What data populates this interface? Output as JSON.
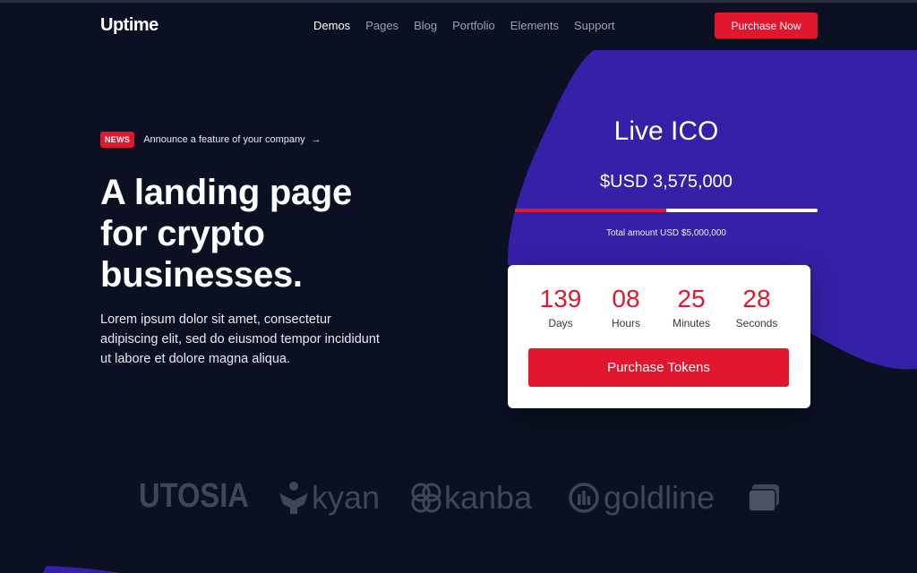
{
  "nav": {
    "logo": "Uptime",
    "items": [
      "Demos",
      "Pages",
      "Blog",
      "Portfolio",
      "Elements",
      "Support"
    ],
    "cta": "Purchase Now"
  },
  "hero": {
    "news_badge": "NEWS",
    "news_text": "Announce a feature of your company",
    "news_arrow": "→",
    "headline_lines": [
      "A landing page",
      "for crypto",
      "businesses."
    ],
    "description": "Lorem ipsum dolor sit amet, consectetur adipiscing elit, sed do eiusmod tempor incididunt ut labore et dolore magna aliqua."
  },
  "ico": {
    "title": "Live ICO",
    "amount": "$USD 3,575,000",
    "progress_fraction": 0.5,
    "total": "Total amount USD $5,000,000"
  },
  "countdown": {
    "days": "139",
    "days_label": "Days",
    "hours": "08",
    "hours_label": "Hours",
    "minutes": "25",
    "minutes_label": "Minutes",
    "seconds": "28",
    "seconds_label": "Seconds",
    "button": "Purchase Tokens"
  },
  "logos": {
    "utosia": "UTOSIA",
    "kyan": "kyan",
    "kanba": "kanba",
    "goldline": "goldline"
  },
  "colors": {
    "background": "#0b1122",
    "accent_red": "#e0172e",
    "blob_purple": "#3520a8",
    "logo_gray": "#3e4759"
  }
}
